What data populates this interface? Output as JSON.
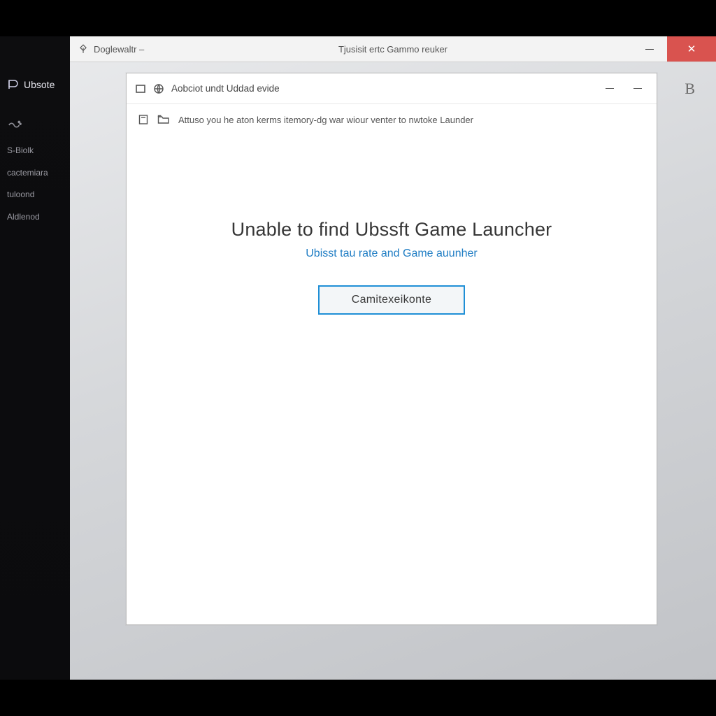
{
  "sidebar": {
    "brand": "Ubsote",
    "items": [
      "S-Biolk",
      "cactemiara",
      "tuloond",
      "Aldlenod"
    ]
  },
  "window": {
    "app_label": "Doglewaltr –",
    "title": "Tjusisit ertc Gammo reuker"
  },
  "corner_letter": "B",
  "dialog": {
    "header": "Aobciot undt Uddad evide",
    "sub": "Attuso you he aton kerms itemory-dg war wiour venter to nwtoke Launder",
    "error_title": "Unable to find Ubssft Game Launcher",
    "error_link": "Ubisst tau rate and Game auunher",
    "button": "Camitexeikonte"
  }
}
